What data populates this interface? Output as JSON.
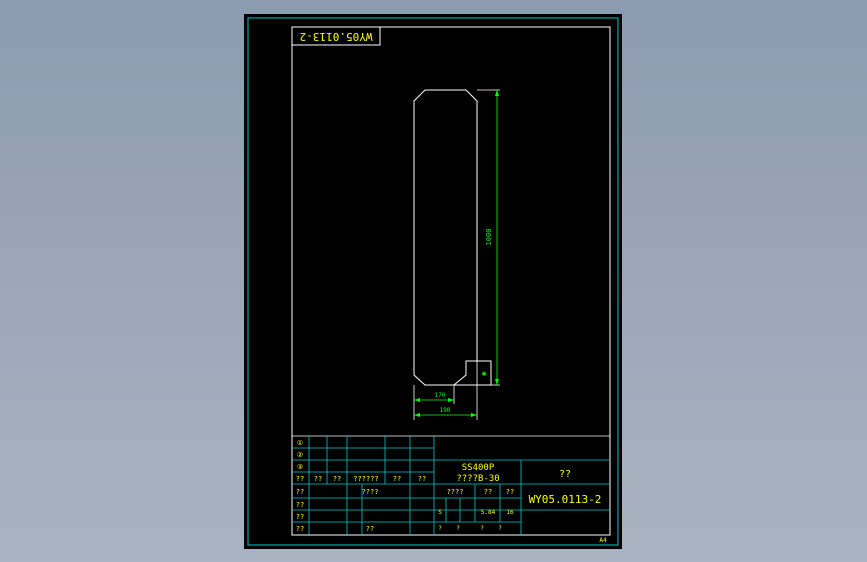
{
  "drawing": {
    "drawing_number": "WY05.0113-2",
    "drawing_number_mirrored": "WY05.0113-2",
    "material": "SS400P",
    "material_spec": "????B-30",
    "title": "??",
    "sheet_size": "A4",
    "colors": {
      "background": "#000000",
      "frame": "#00c8c8",
      "part": "#ffffff",
      "dimension": "#00ff00",
      "text": "#ffff00"
    }
  },
  "dimensions": {
    "height": "1000",
    "thickness_small": "10",
    "width_inner": "170",
    "width_overall": "190"
  },
  "title_block": {
    "revision_marks": [
      "①",
      "②",
      "③"
    ],
    "header_cells": [
      "??",
      "??",
      "??",
      "??????",
      "??",
      "??"
    ],
    "row_labels": [
      "??",
      "??",
      "??",
      "??"
    ],
    "cell_chk": "????",
    "scale_label": "????",
    "scale_col_a": "??",
    "scale_col_b": "??",
    "sheet_no": "S",
    "weight": "5.84",
    "count": "16",
    "footer_cells": [
      "?",
      "?",
      "?",
      "?"
    ],
    "misc_cell": "??"
  }
}
